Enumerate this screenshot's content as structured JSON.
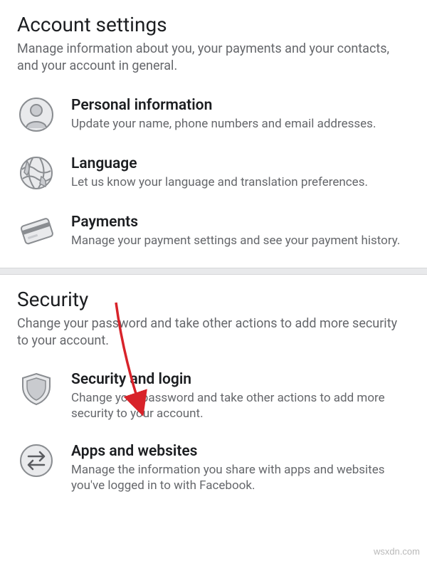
{
  "sections": [
    {
      "title": "Account settings",
      "subtitle": "Manage information about you, your payments and your contacts, and your account in general.",
      "items": [
        {
          "title": "Personal information",
          "desc": "Update your name, phone numbers and email addresses."
        },
        {
          "title": "Language",
          "desc": "Let us know your language and translation preferences."
        },
        {
          "title": "Payments",
          "desc": "Manage your payment settings and see your payment history."
        }
      ]
    },
    {
      "title": "Security",
      "subtitle": "Change your password and take other actions to add more security to your account.",
      "items": [
        {
          "title": "Security and login",
          "desc": "Change your password and take other actions to add more security to your account."
        },
        {
          "title": "Apps and websites",
          "desc": "Manage the information you share with apps and websites you've logged in to with Facebook."
        }
      ]
    }
  ],
  "watermark": "wsxdn.com"
}
